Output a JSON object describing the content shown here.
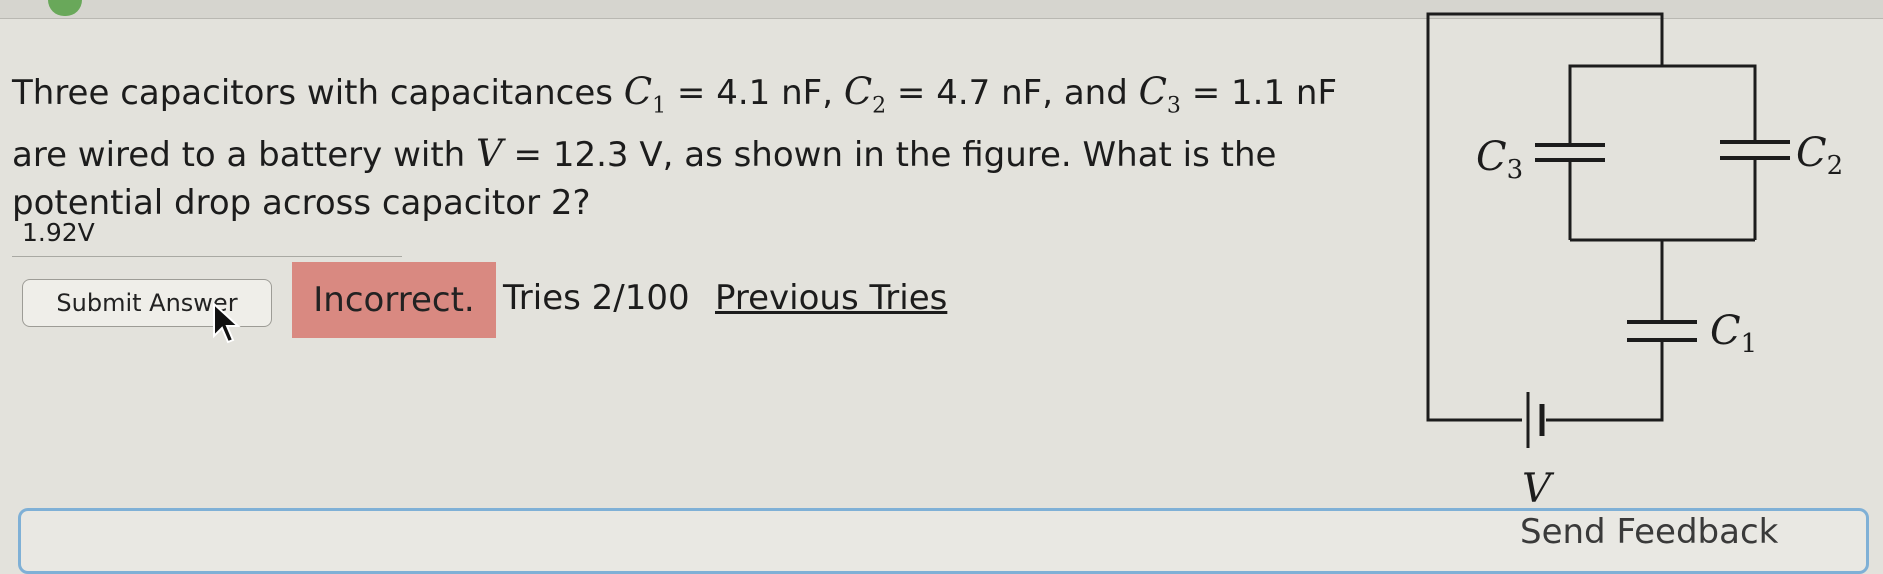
{
  "question": {
    "line1": {
      "lead": "Three capacitors with capacitances ",
      "c1_sym": "C",
      "c1_sub": "1",
      "c1_val": " = 4.1 nF, ",
      "c2_sym": "C",
      "c2_sub": "2",
      "c2_val": " = 4.7 nF, and ",
      "c3_sym": "C",
      "c3_sub": "3",
      "c3_val": " = 1.1 nF"
    },
    "line2": {
      "lead": "are wired to a battery with ",
      "v_sym": "V",
      "v_val": " = 12.3 V, as shown in the figure. What is the"
    },
    "line3": "potential drop across capacitor 2?"
  },
  "answer": {
    "value": "1.92V"
  },
  "submit": {
    "label": "Submit Answer"
  },
  "status": {
    "result": "Incorrect.",
    "tries": "Tries 2/100",
    "previous_tries_link": "Previous Tries"
  },
  "feedback": {
    "partial_text": "Send Feedback"
  },
  "figure": {
    "c3_label": "C",
    "c3_sub": "3",
    "c2_label": "C",
    "c2_sub": "2",
    "c1_label": "C",
    "c1_sub": "1",
    "v_label": "V"
  },
  "colors": {
    "background": "#e3e2dc",
    "incorrect": "#d98981",
    "panel_border": "#7fb0d6",
    "leaf": "#69a85a"
  },
  "icons": [
    "leaf-icon",
    "cursor-icon",
    "battery-icon",
    "capacitor-icon"
  ]
}
